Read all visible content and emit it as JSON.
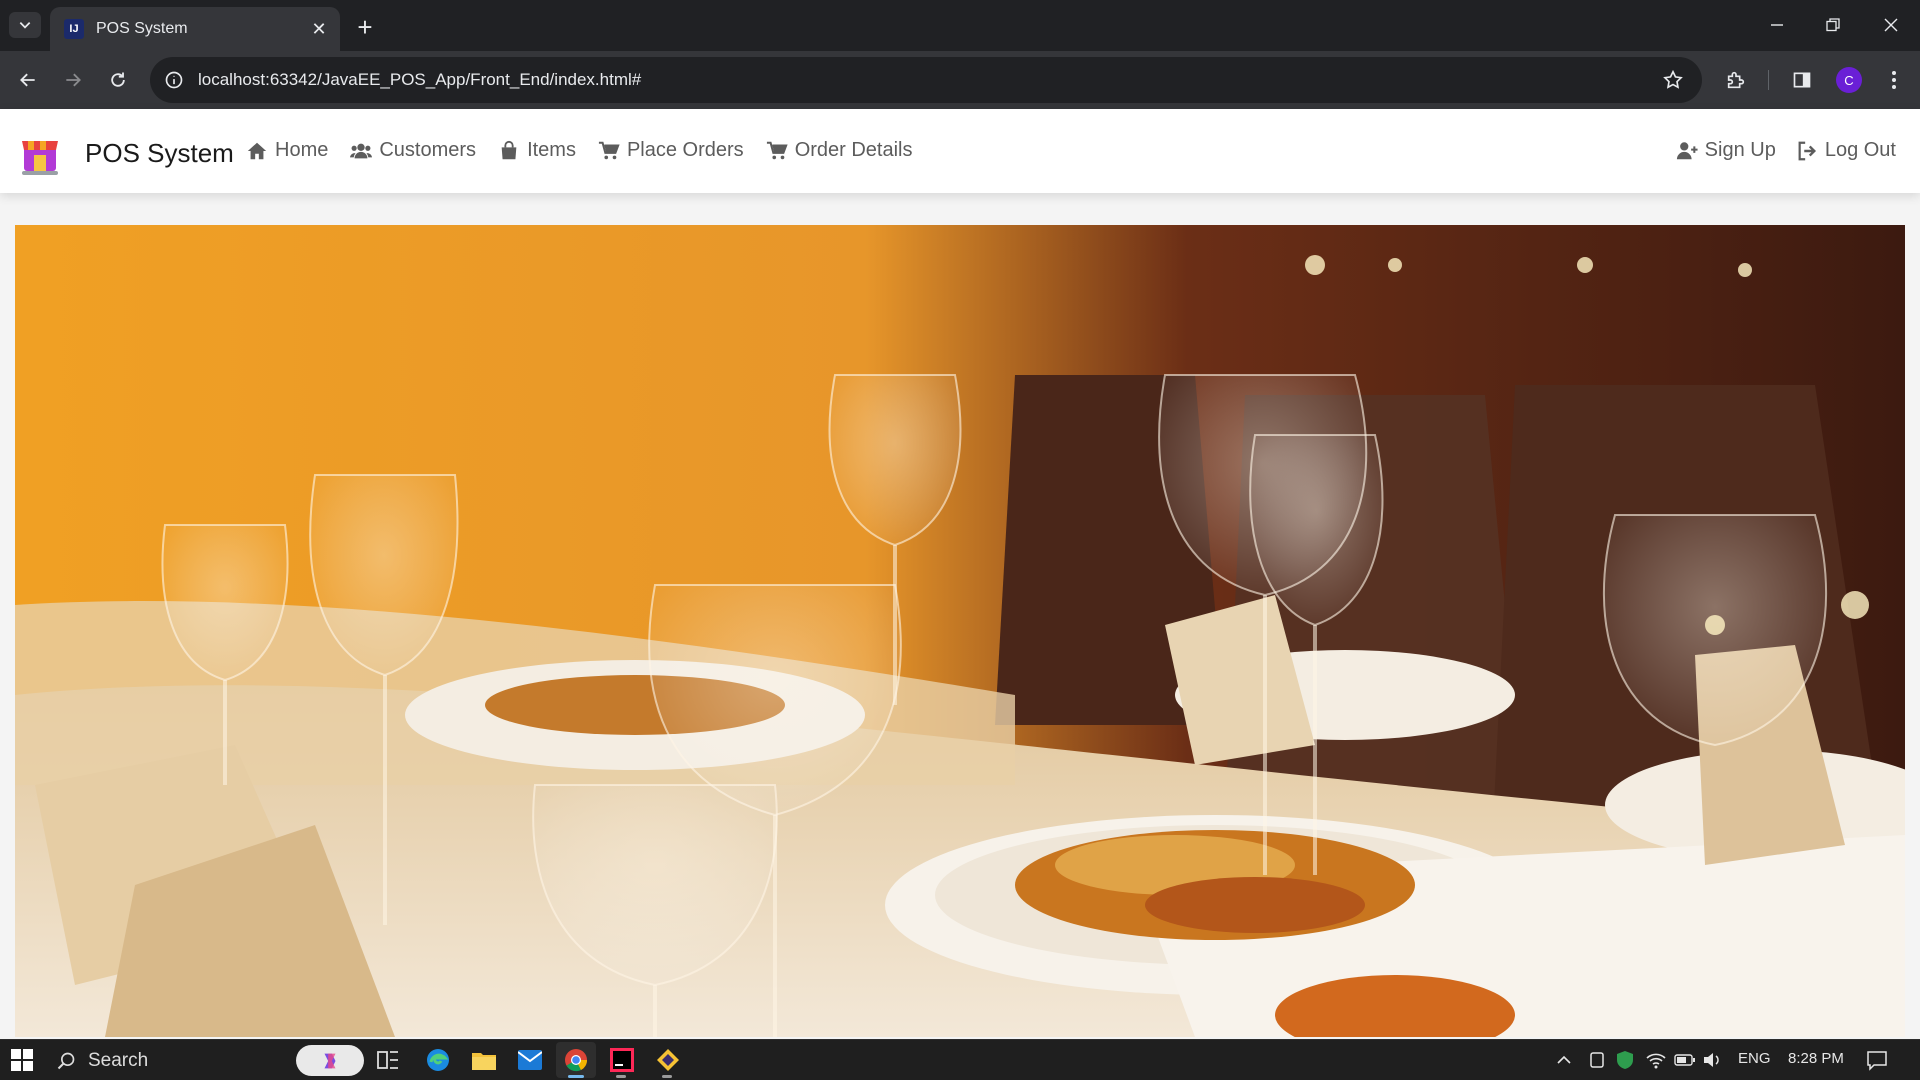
{
  "browser": {
    "tab_title": "POS System",
    "url": "localhost:63342/JavaEE_POS_App/Front_End/index.html#",
    "profile_initial": "C"
  },
  "navbar": {
    "brand": "POS System",
    "links": [
      {
        "label": "Home",
        "icon": "home-icon"
      },
      {
        "label": "Customers",
        "icon": "users-icon"
      },
      {
        "label": "Items",
        "icon": "bag-icon"
      },
      {
        "label": "Place Orders",
        "icon": "cart-icon"
      },
      {
        "label": "Order Details",
        "icon": "cart-icon"
      }
    ],
    "right": [
      {
        "label": "Sign Up",
        "icon": "user-plus-icon"
      },
      {
        "label": "Log Out",
        "icon": "logout-icon"
      }
    ]
  },
  "taskbar": {
    "search_label": "Search",
    "language": "ENG",
    "time": "8:28 PM"
  },
  "colors": {
    "tab_strip": "#202124",
    "toolbar": "#35363a",
    "nav_text": "#5c5c5c",
    "taskbar": "#1f1f1f"
  }
}
